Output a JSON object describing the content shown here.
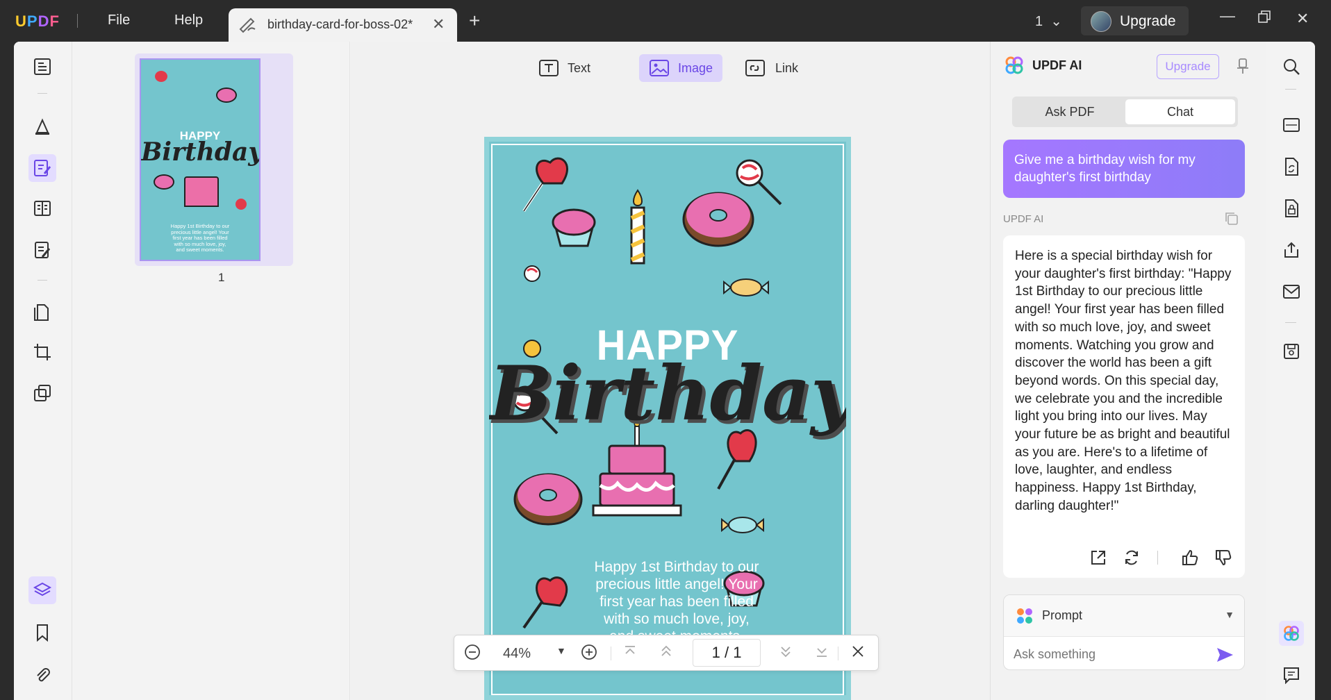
{
  "titlebar": {
    "logo": "UPDF",
    "menu": [
      "File",
      "Help"
    ],
    "tab_title": "birthday-card-for-boss-02*",
    "page_selector": "1",
    "upgrade_label": "Upgrade"
  },
  "left_tools": [
    "reader-icon",
    "comment-icon",
    "edit-pdf-icon",
    "organize-icon",
    "fill-sign-icon",
    "page-tools-icon",
    "crop-icon",
    "batch-icon",
    "layers-icon",
    "bookmark-icon",
    "attachment-icon"
  ],
  "thumbnails": {
    "page_number": "1"
  },
  "edit_toolbar": {
    "text": "Text",
    "image": "Image",
    "link": "Link",
    "active": "Image"
  },
  "card": {
    "happy": "HAPPY",
    "birthday": "Birthday",
    "message_lines": [
      "Happy 1st Birthday to our",
      "precious little angel! Your",
      "first year has been filled",
      "with so much love, joy,",
      "and sweet moments."
    ],
    "thumb_message": [
      "Happy 1st Birthday to our",
      "precious little angel! Your",
      "first year has been filled",
      "with so much love, joy,",
      "and sweet moments."
    ]
  },
  "zoom": {
    "level": "44%",
    "current_page": "1",
    "separator": "/",
    "total_pages": "1"
  },
  "ai": {
    "title": "UPDF AI",
    "upgrade": "Upgrade",
    "tabs": [
      "Ask PDF",
      "Chat"
    ],
    "active_tab": "Chat",
    "user_message": "Give me a birthday wish for my daughter's first birthday",
    "responder_label": "UPDF AI",
    "response": "Here is a special birthday wish for your daughter's first birthday: \"Happy 1st Birthday to our precious little angel! Your first year has been filled with so much love, joy, and sweet moments. Watching you grow and discover the world has been a gift beyond words. On this special day, we celebrate you and the incredible light you bring into our lives. May your future be as bright and beautiful as you are. Here's to a lifetime of love, laughter, and endless happiness. Happy 1st Birthday, darling daughter!\"",
    "prompt_label": "Prompt",
    "input_placeholder": "Ask something"
  },
  "colors": {
    "accent": "#7b5cf0",
    "card_bg": "#74c5cd",
    "titlebar": "#2b2b2b"
  }
}
